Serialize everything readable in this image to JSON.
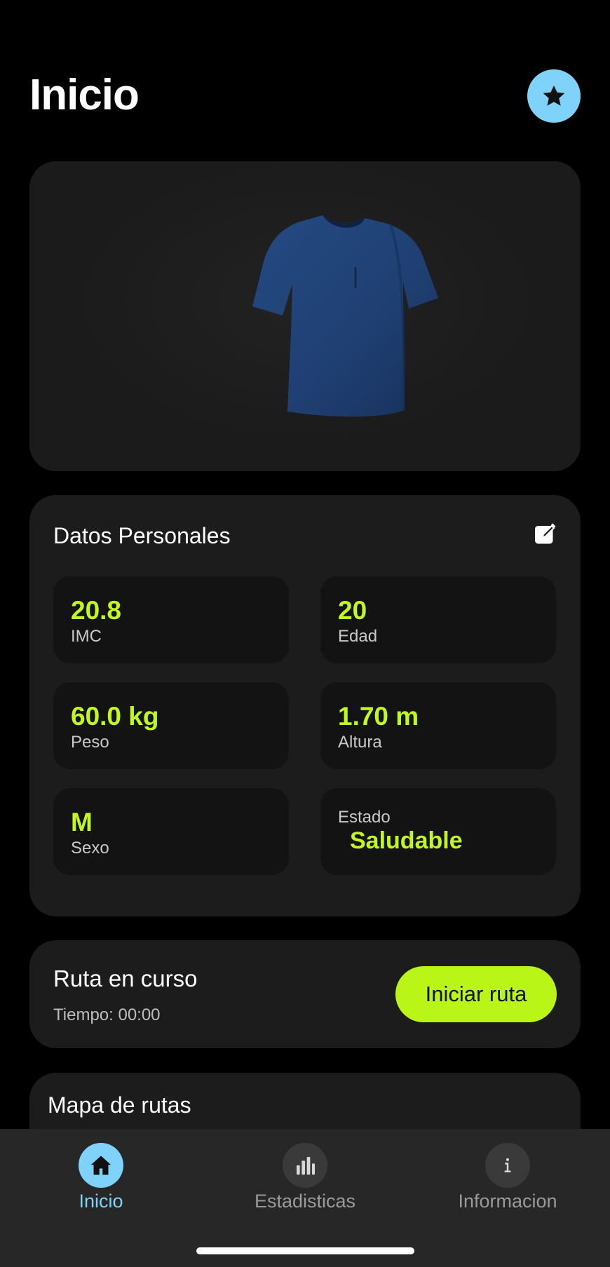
{
  "header": {
    "title": "Inicio",
    "favorite_icon": "star-icon"
  },
  "hero": {
    "image": "blue-tshirt-image",
    "shirt_color": "#1f3f72"
  },
  "personal": {
    "title": "Datos Personales",
    "edit_icon": "edit-icon",
    "stats": [
      {
        "value": "20.8",
        "label": "IMC"
      },
      {
        "value": "20",
        "label": "Edad"
      },
      {
        "value": "60.0 kg",
        "label": "Peso"
      },
      {
        "value": "1.70 m",
        "label": "Altura"
      },
      {
        "value": "M",
        "label": "Sexo"
      }
    ],
    "estado": {
      "label": "Estado",
      "value": "Saludable"
    }
  },
  "route": {
    "title": "Ruta en curso",
    "time": "Tiempo: 00:00",
    "start_label": "Iniciar ruta"
  },
  "map": {
    "title": "Mapa de rutas"
  },
  "tabbar": {
    "tabs": [
      {
        "label": "Inicio",
        "icon": "home-icon",
        "active": true
      },
      {
        "label": "Estadisticas",
        "icon": "bar-chart-icon",
        "active": false
      },
      {
        "label": "Informacion",
        "icon": "info-icon",
        "active": false
      }
    ]
  },
  "colors": {
    "accent_green": "#c3f81b",
    "accent_blue": "#7fd3fb",
    "card_bg": "#1c1c1c",
    "background": "#000000"
  }
}
